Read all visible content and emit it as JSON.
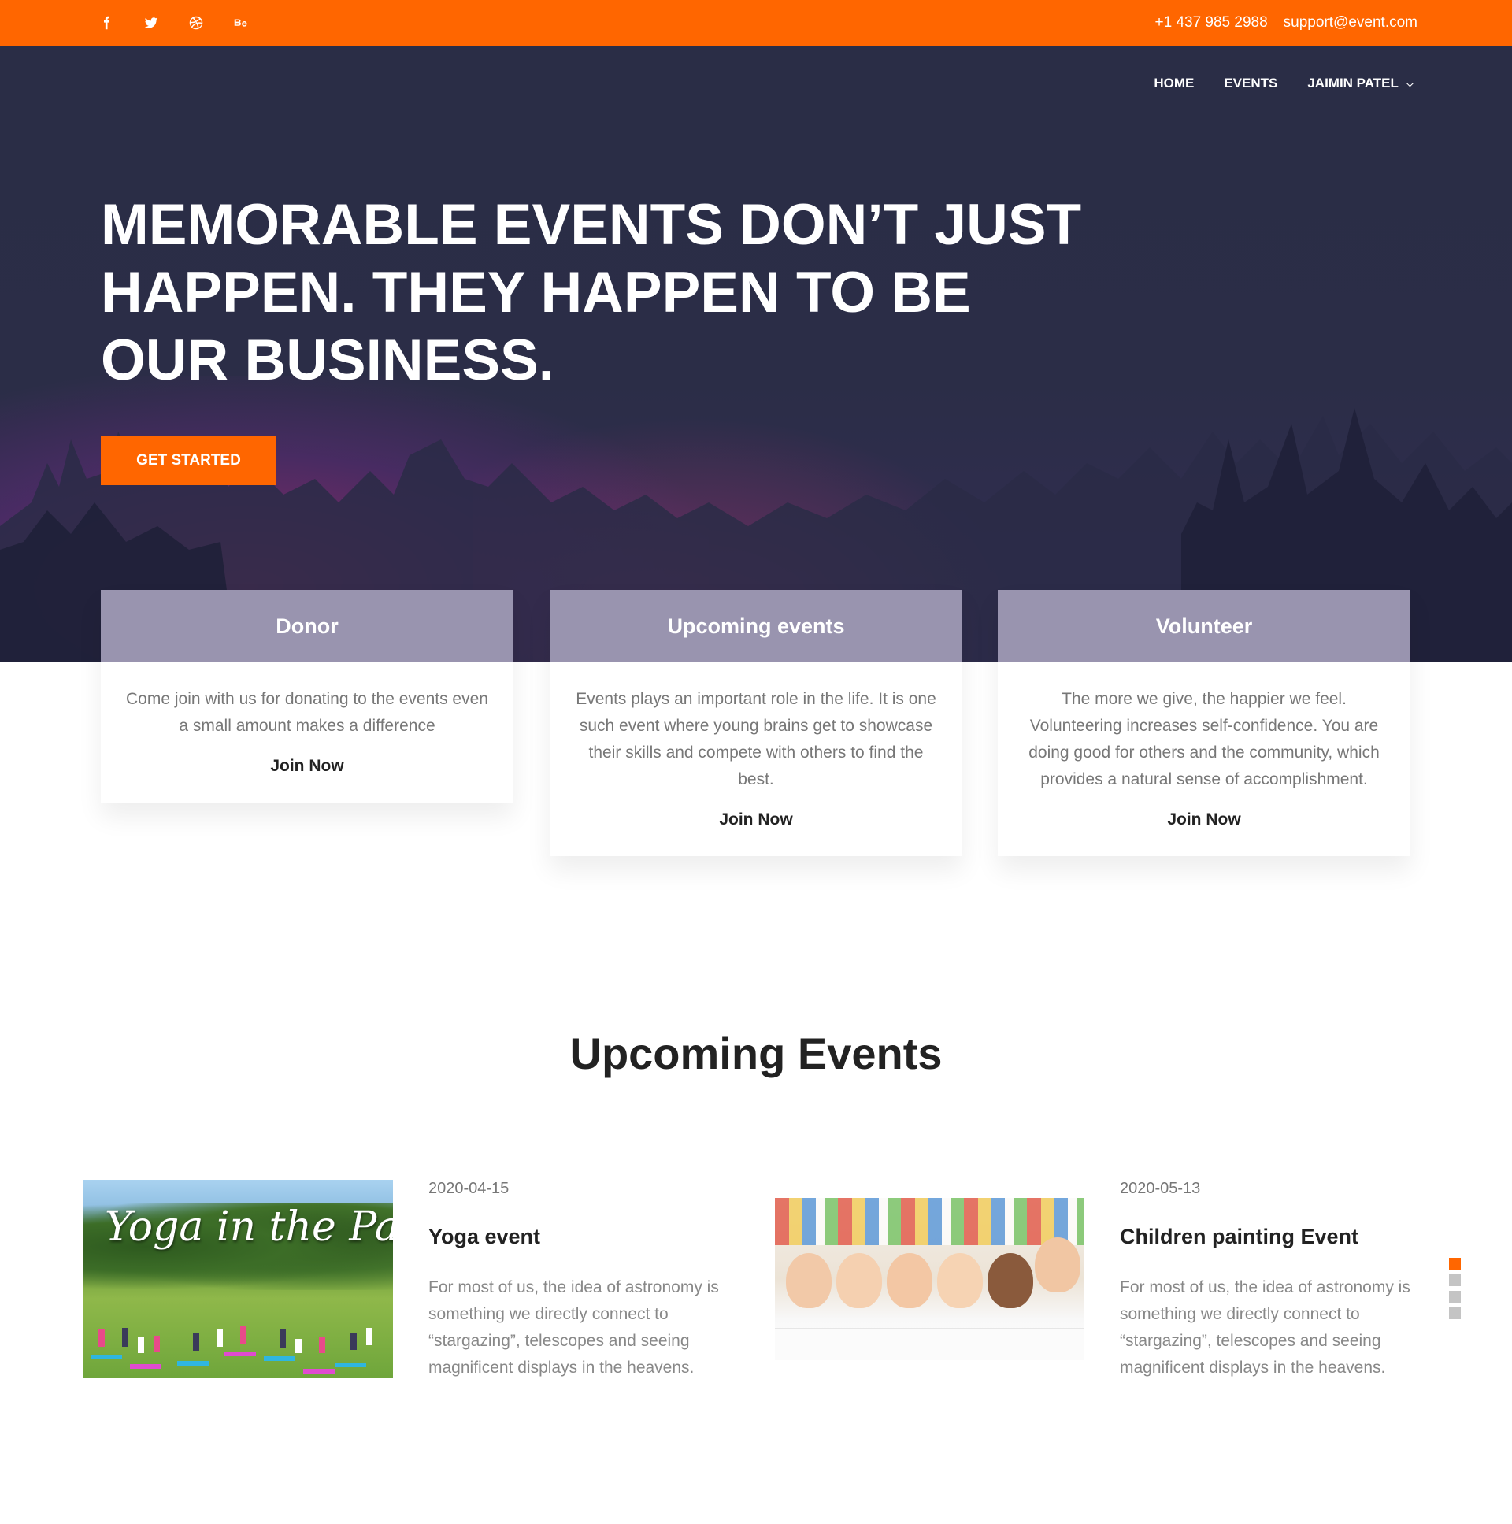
{
  "topbar": {
    "social": [
      {
        "name": "facebook-icon",
        "glyph": "f"
      },
      {
        "name": "twitter-icon",
        "glyph": ""
      },
      {
        "name": "dribbble-icon",
        "glyph": ""
      },
      {
        "name": "behance-icon",
        "glyph": "Bē"
      }
    ],
    "phone": "+1 437 985 2988",
    "email": "support@event.com",
    "bg_color": "#ff6600"
  },
  "nav": {
    "home": "HOME",
    "events": "EVENTS",
    "user": "JAIMIN PATEL"
  },
  "hero": {
    "title": "MEMORABLE EVENTS DON’T JUST HAPPEN. THEY HAPPEN TO BE OUR BUSINESS.",
    "cta": "GET STARTED"
  },
  "cards": [
    {
      "title": "Donor",
      "text": "Come join with us for donating to the events even a small amount makes a difference",
      "link": "Join Now"
    },
    {
      "title": "Upcoming events",
      "text": "Events plays an important role in the life. It is one such event where young brains get to showcase their skills and compete with others to find the best.",
      "link": "Join Now"
    },
    {
      "title": "Volunteer",
      "text": "The more we give, the happier we feel. Volunteering increases self-confidence. You are doing good for others and the community, which provides a natural sense of accomplishment.",
      "link": "Join Now"
    }
  ],
  "upcoming": {
    "title": "Upcoming Events",
    "events": [
      {
        "image_text": "Yoga in the Park",
        "date": "2020-04-15",
        "title": "Yoga event",
        "desc": "For most of us, the idea of astronomy is something we directly connect to “stargazing”, telescopes and seeing magnificent displays in the heavens."
      },
      {
        "date": "2020-05-13",
        "title": "Children painting Event",
        "desc": "For most of us, the idea of astronomy is something we directly connect to “stargazing”, telescopes and seeing magnificent displays in the heavens."
      }
    ],
    "active_page": 1,
    "page_count": 4
  },
  "colors": {
    "accent": "#ff6600",
    "hero_bg": "#2b2d47"
  }
}
